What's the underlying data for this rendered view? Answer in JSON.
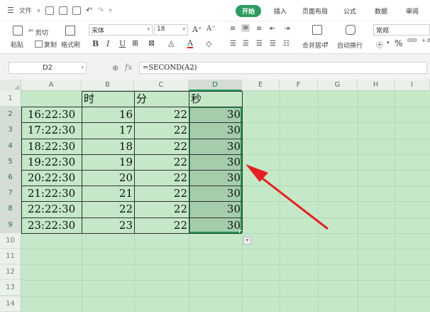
{
  "menubar": {
    "file_label": "文件",
    "tabs": [
      "开始",
      "插入",
      "页面布局",
      "公式",
      "数据",
      "审阅"
    ],
    "active_tab": "开始"
  },
  "ribbon": {
    "paste_label": "粘贴",
    "cut_label": "剪切",
    "copy_label": "复制",
    "format_painter_label": "格式刷",
    "font_name": "宋体",
    "font_size": "18",
    "merge_center_label": "合并居中",
    "wrap_text_label": "自动换行",
    "number_format": "常规",
    "percent_symbol": "%",
    "thousands_symbol": "000",
    "decimal_symbol": "+.0"
  },
  "formulabar": {
    "name_box": "D2",
    "fx_label": "fx",
    "formula": "=SECOND(A2)"
  },
  "grid": {
    "columns": [
      "A",
      "B",
      "C",
      "D",
      "E",
      "F",
      "G",
      "H",
      "I"
    ],
    "rows": [
      "1",
      "2",
      "3",
      "4",
      "5",
      "6",
      "7",
      "8",
      "9",
      "10",
      "11",
      "12",
      "13",
      "14"
    ],
    "headers": [
      "",
      "时",
      "分",
      "秒"
    ],
    "data": [
      [
        "16:22:30",
        "16",
        "22",
        "30"
      ],
      [
        "17:22:30",
        "17",
        "22",
        "30"
      ],
      [
        "18:22:30",
        "18",
        "22",
        "30"
      ],
      [
        "19:22:30",
        "19",
        "22",
        "30"
      ],
      [
        "20:22:30",
        "20",
        "22",
        "30"
      ],
      [
        "21:22:30",
        "21",
        "22",
        "30"
      ],
      [
        "22:22:30",
        "22",
        "22",
        "30"
      ],
      [
        "23:22:30",
        "23",
        "22",
        "30"
      ]
    ],
    "selected_column": "D",
    "selection_rows": [
      "2",
      "9"
    ]
  },
  "colors": {
    "sheet_background": "#c5e8c8",
    "accent": "#2c9c5f",
    "arrow": "#e82020"
  }
}
